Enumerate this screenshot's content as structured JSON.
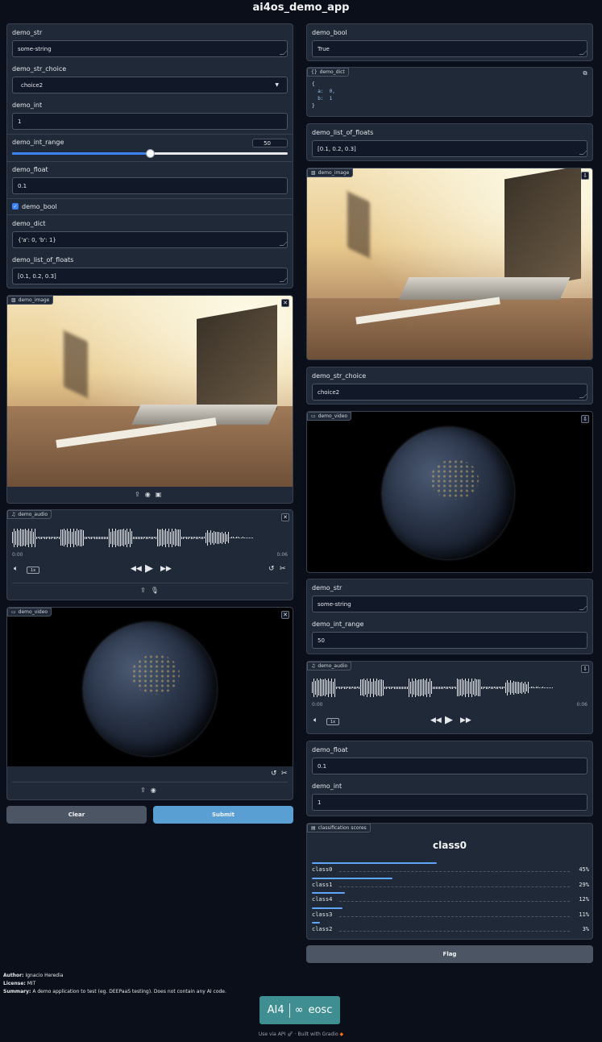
{
  "app_title": "ai4os_demo_app",
  "left": {
    "demo_str": {
      "label": "demo_str",
      "value": "some-string"
    },
    "demo_str_choice": {
      "label": "demo_str_choice",
      "value": "choice2"
    },
    "demo_int": {
      "label": "demo_int",
      "value": "1"
    },
    "demo_int_range": {
      "label": "demo_int_range",
      "value": "50",
      "fraction": 0.5
    },
    "demo_float": {
      "label": "demo_float",
      "value": "0.1"
    },
    "demo_bool": {
      "label": "demo_bool",
      "checked": true
    },
    "demo_dict": {
      "label": "demo_dict",
      "value": "{'a': 0, 'b': 1}"
    },
    "demo_list_of_floats": {
      "label": "demo_list_of_floats",
      "value": "[0.1, 0.2, 0.3]"
    },
    "demo_image": {
      "label": "demo_image"
    },
    "demo_audio": {
      "label": "demo_audio",
      "time_start": "0:00",
      "time_end": "0:06",
      "speed": "1x"
    },
    "demo_video": {
      "label": "demo_video"
    },
    "clear_label": "Clear",
    "submit_label": "Submit"
  },
  "right": {
    "demo_bool": {
      "label": "demo_bool",
      "value": "True"
    },
    "demo_dict": {
      "label": "demo_dict",
      "lines": [
        "{",
        "  a:  0,",
        "  b:  1",
        "}"
      ]
    },
    "demo_list_of_floats": {
      "label": "demo_list_of_floats",
      "value": "[0.1, 0.2, 0.3]"
    },
    "demo_image": {
      "label": "demo_image"
    },
    "demo_str_choice": {
      "label": "demo_str_choice",
      "value": "choice2"
    },
    "demo_video": {
      "label": "demo_video"
    },
    "demo_str": {
      "label": "demo_str",
      "value": "some-string"
    },
    "demo_int_range": {
      "label": "demo_int_range",
      "value": "50"
    },
    "demo_audio": {
      "label": "demo_audio",
      "time_start": "0:00",
      "time_end": "0:06",
      "speed": "1x"
    },
    "demo_float": {
      "label": "demo_float",
      "value": "0.1"
    },
    "demo_int": {
      "label": "demo_int",
      "value": "1"
    },
    "classification": {
      "label": "classification scores",
      "top_class": "class0",
      "scores": [
        {
          "name": "class0",
          "pct": "45%",
          "value": 0.45
        },
        {
          "name": "class1",
          "pct": "29%",
          "value": 0.29
        },
        {
          "name": "class4",
          "pct": "12%",
          "value": 0.12
        },
        {
          "name": "class3",
          "pct": "11%",
          "value": 0.11
        },
        {
          "name": "class2",
          "pct": "3%",
          "value": 0.03
        }
      ]
    },
    "flag_label": "Flag"
  },
  "footer": {
    "author_key": "Author:",
    "author_val": "Ignacio Heredia",
    "license_key": "License:",
    "license_val": "MIT",
    "summary_key": "Summary:",
    "summary_val": "A demo application to test (eg. DEEPaaS testing). Does not contain any AI code.",
    "logo_left": "AI4",
    "logo_right": "eosc",
    "api_link": "Use via API",
    "built_with": "Built with Gradio"
  },
  "colors": {
    "accent": "#5a9fd4",
    "background": "#0b0f19",
    "panel": "#1f2937"
  }
}
